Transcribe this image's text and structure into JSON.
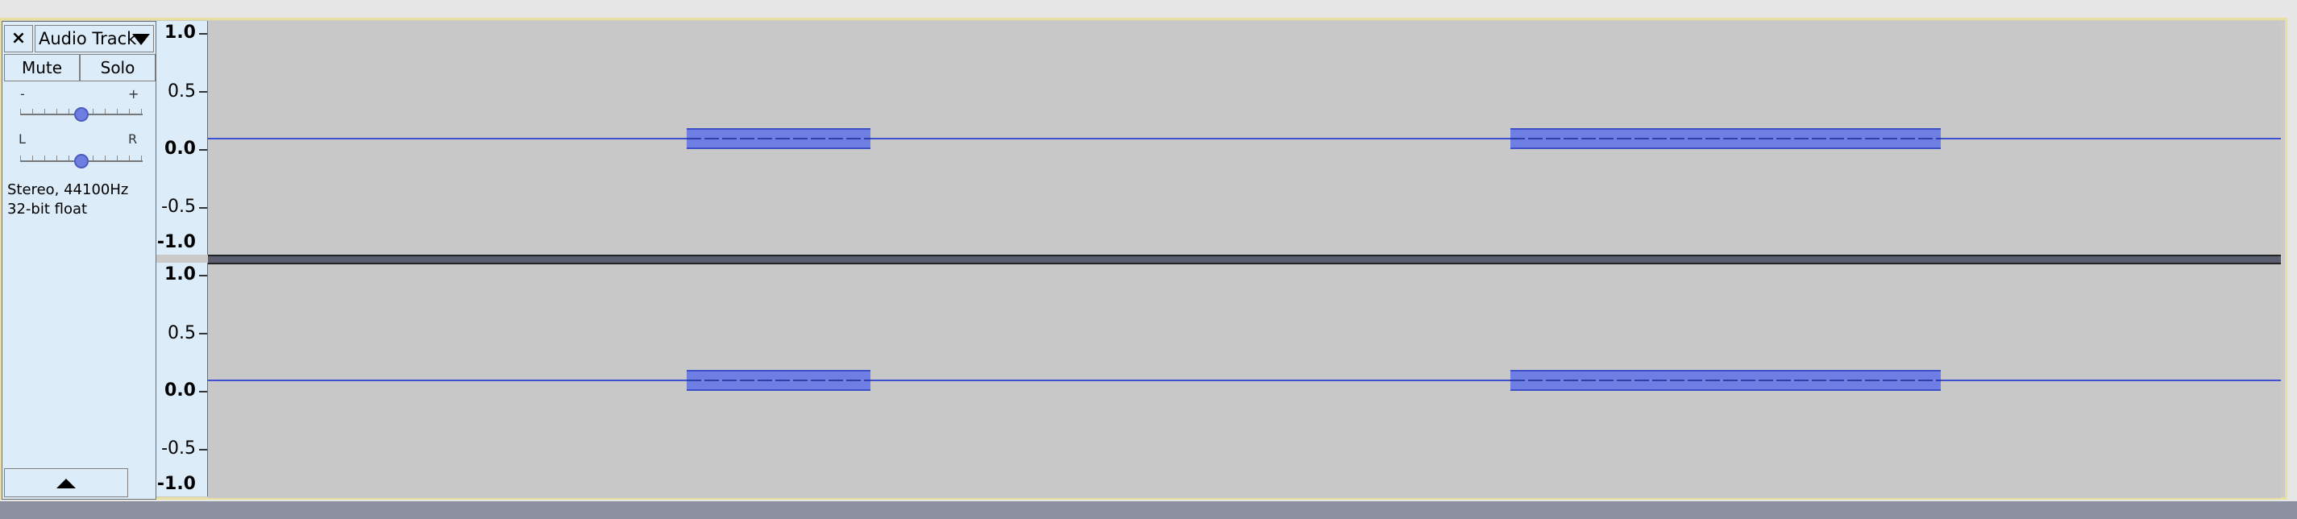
{
  "track": {
    "name": "Audio Track",
    "close_icon": "close-icon",
    "menu_icon": "dropdown-arrow-icon",
    "mute_label": "Mute",
    "solo_label": "Solo",
    "gain": {
      "min_label": "-",
      "max_label": "+",
      "value": 0.5
    },
    "pan": {
      "left_label": "L",
      "right_label": "R",
      "value": 0.5
    },
    "format_line1": "Stereo, 44100Hz",
    "format_line2": "32-bit float",
    "collapse_icon": "collapse-up-icon"
  },
  "ruler_top": {
    "labels": [
      "1.0",
      "0.5",
      "0.0",
      "-0.5",
      "-1.0"
    ]
  },
  "ruler_bottom": {
    "labels": [
      "1.0",
      "0.5",
      "0.0",
      "-0.5",
      "-1.0"
    ]
  },
  "colors": {
    "waveform": "#6f7ee3",
    "zero_line": "#3c50d0",
    "panel_bg": "#dcecf9",
    "track_bg": "#c8c8c8",
    "selected_border": "#e8e0a0"
  }
}
